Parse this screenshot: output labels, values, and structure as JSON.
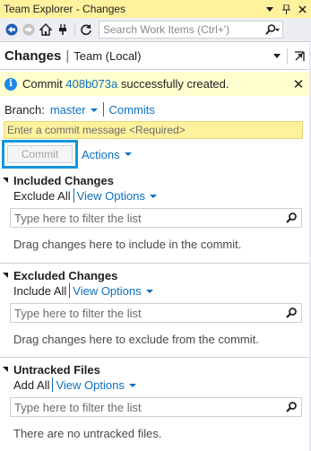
{
  "window": {
    "title": "Team Explorer - Changes"
  },
  "toolbar": {
    "search_placeholder": "Search Work Items (Ctrl+')"
  },
  "header": {
    "page_title": "Changes",
    "context": "Team (Local)"
  },
  "notification": {
    "prefix": "Commit ",
    "commit_id": "408b073a",
    "suffix": " successfully created."
  },
  "branch": {
    "label": "Branch:",
    "name": "master",
    "commits_link": "Commits"
  },
  "commit": {
    "message_placeholder": "Enter a commit message <Required>",
    "commit_button": "Commit",
    "actions": "Actions"
  },
  "sections": {
    "included": {
      "title": "Included Changes",
      "action": "Exclude All",
      "view_options": "View Options",
      "filter_placeholder": "Type here to filter the list",
      "hint": "Drag changes here to include in the commit."
    },
    "excluded": {
      "title": "Excluded Changes",
      "action": "Include All",
      "view_options": "View Options",
      "filter_placeholder": "Type here to filter the list",
      "hint": "Drag changes here to exclude from the commit."
    },
    "untracked": {
      "title": "Untracked Files",
      "action": "Add All",
      "view_options": "View Options",
      "filter_placeholder": "Type here to filter the list",
      "hint": "There are no untracked files."
    }
  },
  "colors": {
    "title_bar": "#fff29d",
    "link": "#0e70c0",
    "highlight_border": "#1296db",
    "notification_bg": "#fefece"
  },
  "icons": {
    "back": "back-arrow-icon",
    "forward": "forward-arrow-icon",
    "home": "home-icon",
    "connect": "plug-icon",
    "refresh": "refresh-icon",
    "search": "search-icon",
    "info": "info-icon",
    "close": "close-icon",
    "pin": "pin-icon",
    "popout": "popout-icon"
  }
}
